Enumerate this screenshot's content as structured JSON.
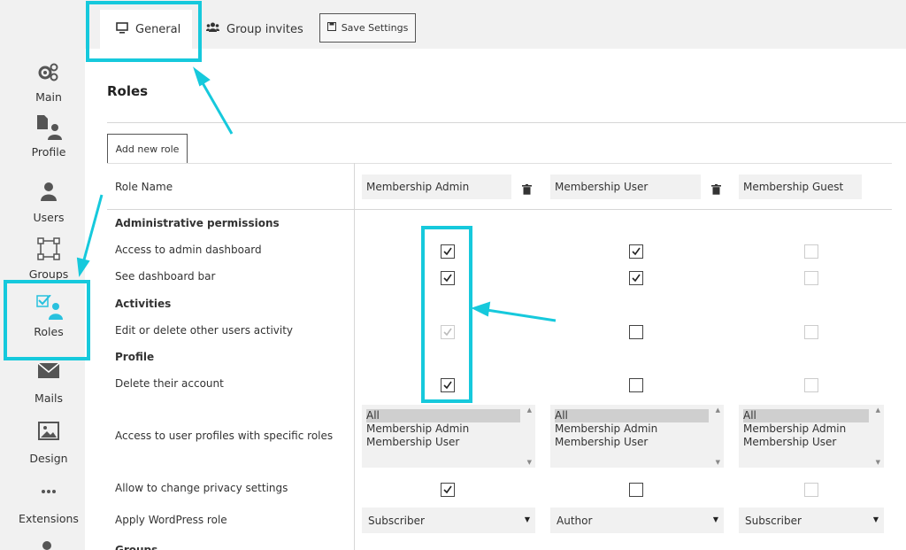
{
  "sidebar": {
    "items": [
      {
        "label": "Main"
      },
      {
        "label": "Profile"
      },
      {
        "label": "Users"
      },
      {
        "label": "Groups"
      },
      {
        "label": "Roles"
      },
      {
        "label": "Mails"
      },
      {
        "label": "Design"
      },
      {
        "label": "Extensions"
      }
    ]
  },
  "tabs": {
    "general": "General",
    "group_invites": "Group invites",
    "save": "Save Settings"
  },
  "roles": {
    "title": "Roles",
    "add_new": "Add new role",
    "role_name_label": "Role Name",
    "role_names": [
      "Membership Admin",
      "Membership User",
      "Membership Guest"
    ]
  },
  "permissions": {
    "administrative_heading": "Administrative permissions",
    "access_admin_dashboard": "Access to admin dashboard",
    "see_dashboard_bar": "See dashboard bar",
    "activities_heading": "Activities",
    "edit_delete_activity": "Edit or delete other users activity",
    "profile_heading": "Profile",
    "delete_account": "Delete their account",
    "access_profiles": "Access to user profiles with specific roles",
    "change_privacy": "Allow to change privacy settings",
    "apply_wp_role": "Apply WordPress role",
    "next_heading_partial": "Groups"
  },
  "checkboxes": {
    "access_admin_dashboard": [
      true,
      true,
      false
    ],
    "see_dashboard_bar": [
      true,
      true,
      false
    ],
    "edit_delete_activity": [
      true,
      false,
      false
    ],
    "delete_account": [
      true,
      false,
      false
    ],
    "change_privacy": [
      true,
      false,
      false
    ]
  },
  "profile_role_options": [
    "All",
    "Membership Admin",
    "Membership User"
  ],
  "profile_role_selected": "All",
  "wp_roles": [
    "Subscriber",
    "Author",
    "Subscriber"
  ],
  "colors": {
    "accent": "#16c9dc",
    "active_icon": "#29c1de"
  }
}
